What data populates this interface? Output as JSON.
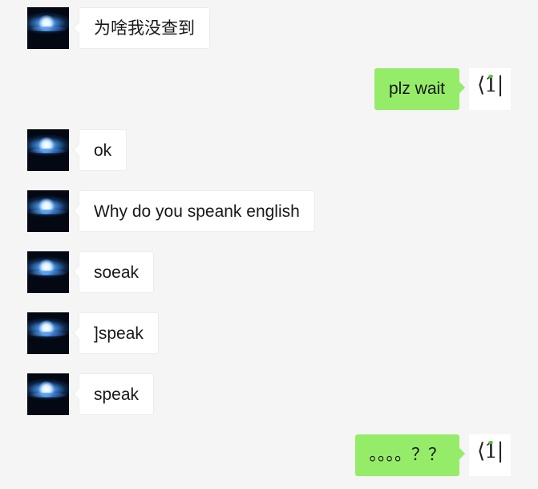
{
  "messages": [
    {
      "side": "left",
      "text": "为啥我没查到"
    },
    {
      "side": "right",
      "text": "plz wait"
    },
    {
      "side": "left",
      "text": "ok"
    },
    {
      "side": "left",
      "text": "Why do you speank english"
    },
    {
      "side": "left",
      "text": "soeak"
    },
    {
      "side": "left",
      "text": "]speak"
    },
    {
      "side": "left",
      "text": "speak"
    },
    {
      "side": "right",
      "text": "。。。。？？"
    }
  ],
  "self_avatar_label": "⟨1|",
  "colors": {
    "background": "#f5f5f5",
    "incoming_bubble": "#ffffff",
    "outgoing_bubble": "#95ec69",
    "text": "#191919"
  },
  "icons": {
    "contact_avatar": "blue-light-flare-avatar",
    "self_avatar": "bra-one-symbol-avatar"
  }
}
